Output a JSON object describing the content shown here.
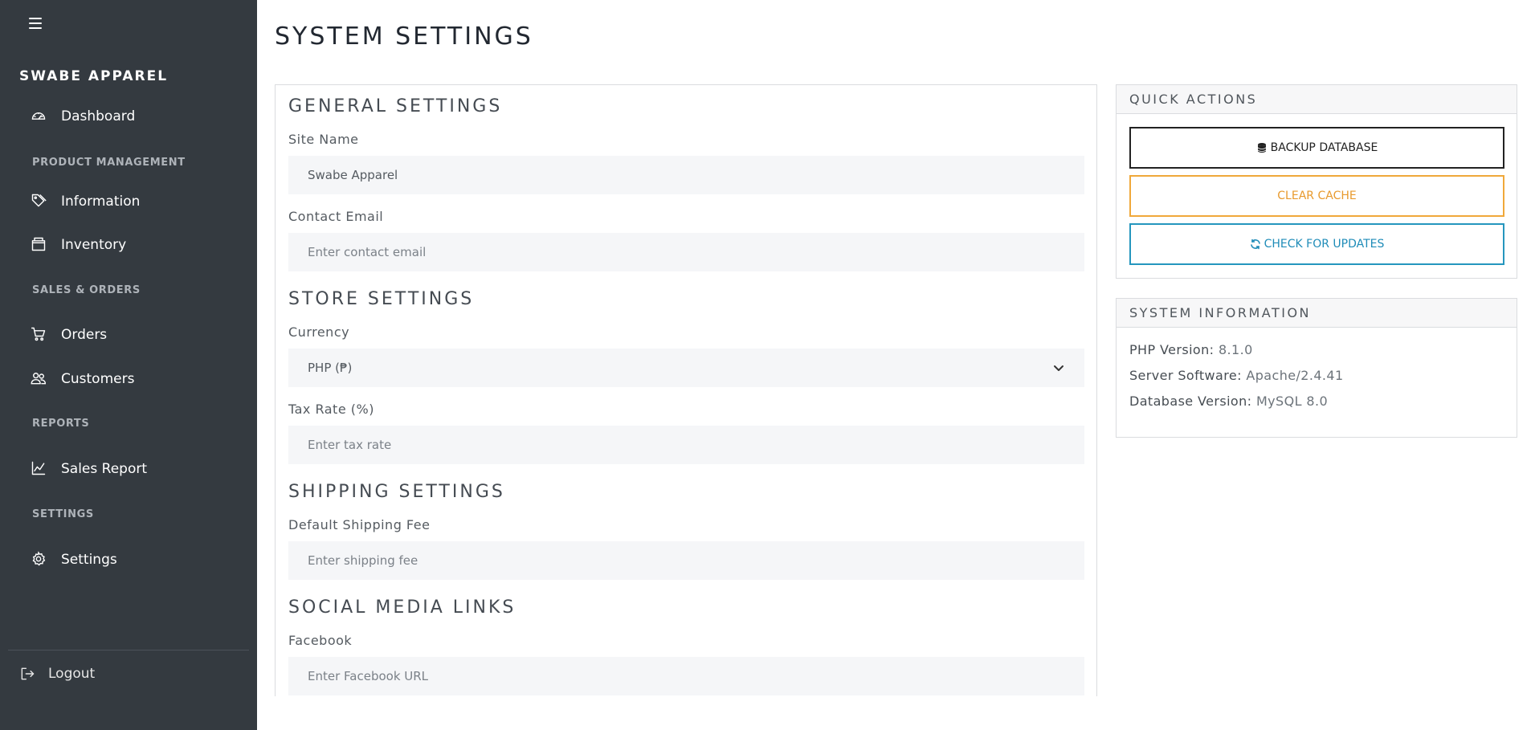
{
  "sidebar": {
    "brand": "SWABE APPAREL",
    "items": {
      "dashboard": "Dashboard",
      "information": "Information",
      "inventory": "Inventory",
      "orders": "Orders",
      "customers": "Customers",
      "sales_report": "Sales Report",
      "settings": "Settings"
    },
    "sections": {
      "product_management": "PRODUCT MANAGEMENT",
      "sales_orders": "SALES & ORDERS",
      "reports": "REPORTS",
      "settings": "SETTINGS"
    },
    "logout": "Logout"
  },
  "page": {
    "title": "SYSTEM SETTINGS"
  },
  "general": {
    "title": "GENERAL SETTINGS",
    "site_name_label": "Site Name",
    "site_name_value": "Swabe Apparel",
    "contact_email_label": "Contact Email",
    "contact_email_placeholder": "Enter contact email"
  },
  "store": {
    "title": "STORE SETTINGS",
    "currency_label": "Currency",
    "currency_value": "PHP (₱)",
    "tax_label": "Tax Rate (%)",
    "tax_placeholder": "Enter tax rate"
  },
  "shipping": {
    "title": "SHIPPING SETTINGS",
    "fee_label": "Default Shipping Fee",
    "fee_placeholder": "Enter shipping fee"
  },
  "social": {
    "title": "SOCIAL MEDIA LINKS",
    "facebook_label": "Facebook",
    "facebook_placeholder": "Enter Facebook URL"
  },
  "quick_actions": {
    "title": "QUICK ACTIONS",
    "backup": "BACKUP DATABASE",
    "clear_cache": "CLEAR CACHE",
    "check_updates": "CHECK FOR UPDATES"
  },
  "system_info": {
    "title": "SYSTEM INFORMATION",
    "php_label": "PHP Version:",
    "php_value": "8.1.0",
    "server_label": "Server Software:",
    "server_value": "Apache/2.4.41",
    "db_label": "Database Version:",
    "db_value": "MySQL 8.0"
  },
  "colors": {
    "sidebar_bg": "#343a40",
    "warning": "#f0a83a",
    "info": "#2596be"
  }
}
